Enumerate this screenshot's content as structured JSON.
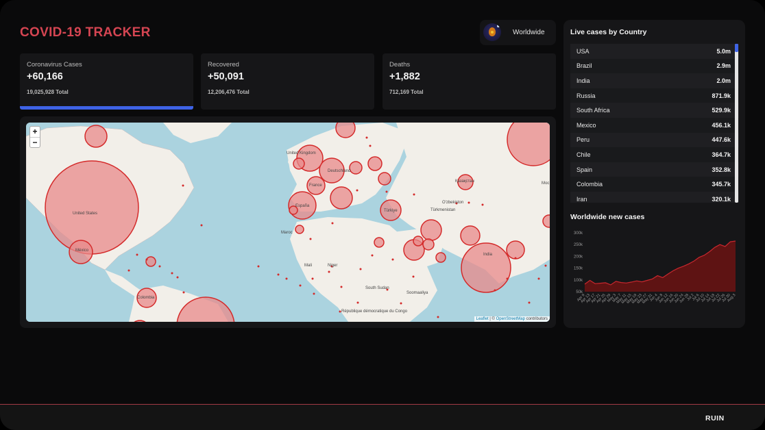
{
  "header": {
    "title": "COVID-19 TRACKER"
  },
  "country_select": {
    "selected": "Worldwide",
    "icon": "owl-globe-icon"
  },
  "stats": [
    {
      "title": "Coronavirus Cases",
      "value": "+60,166",
      "total": "19,025,928 Total",
      "active": true
    },
    {
      "title": "Recovered",
      "value": "+50,091",
      "total": "12,206,476 Total",
      "active": false
    },
    {
      "title": "Deaths",
      "value": "+1,882",
      "total": "712,169 Total",
      "active": false
    }
  ],
  "map": {
    "zoom_in": "+",
    "zoom_out": "−",
    "attribution_leaflet": "Leaflet",
    "attribution_sep": " | © ",
    "attribution_osm": "OpenStreetMap",
    "attribution_tail": " contributors",
    "labels": {
      "us": "United States",
      "mexico": "México",
      "france": "France",
      "espana": "España",
      "turkey": "Türkiye",
      "india": "India",
      "colombia": "Colombia",
      "niger": "Niger",
      "mali": "Mali",
      "south_sudan": "South Sudan",
      "rdc": "République démocratique du Congo",
      "soomaaliya": "Soomaaliya",
      "kazakhstan": "Қазақстан",
      "turkmenistan": "Türkmenistan",
      "uzbekistan": "O'zbekiston",
      "maroc": "Maroc",
      "united_kingdom": "United Kingdom",
      "deutschland": "Deutschland",
      "moscow": "Мос"
    },
    "colors": {
      "circle_fill": "#e88a8a",
      "circle_stroke": "#d42a2a",
      "water": "#abd3df",
      "land": "#f2efe9"
    }
  },
  "sidebar": {
    "live_title": "Live cases by Country",
    "countries": [
      {
        "name": "USA",
        "cases": "5.0m"
      },
      {
        "name": "Brazil",
        "cases": "2.9m"
      },
      {
        "name": "India",
        "cases": "2.0m"
      },
      {
        "name": "Russia",
        "cases": "871.9k"
      },
      {
        "name": "South Africa",
        "cases": "529.9k"
      },
      {
        "name": "Mexico",
        "cases": "456.1k"
      },
      {
        "name": "Peru",
        "cases": "447.6k"
      },
      {
        "name": "Chile",
        "cases": "364.7k"
      },
      {
        "name": "Spain",
        "cases": "352.8k"
      },
      {
        "name": "Colombia",
        "cases": "345.7k"
      },
      {
        "name": "Iran",
        "cases": "320.1k"
      }
    ],
    "chart_title": "Worldwide new cases"
  },
  "chart_data": {
    "type": "area",
    "ylim": [
      50000,
      300000
    ],
    "yticks": [
      "50k",
      "100k",
      "150k",
      "200k",
      "250k",
      "300k"
    ],
    "ytick_values": [
      50000,
      100000,
      150000,
      200000,
      250000,
      300000
    ],
    "x": [
      "Apr 9",
      "Apr 13",
      "Apr 17",
      "Apr 21",
      "Apr 25",
      "Apr 29",
      "May 3",
      "May 7",
      "May 11",
      "May 15",
      "May 19",
      "May 23",
      "May 27",
      "May 31",
      "Jun 4",
      "Jun 8",
      "Jun 12",
      "Jun 16",
      "Jun 20",
      "Jun 24",
      "Jun 28",
      "Jul 2",
      "Jul 6",
      "Jul 10",
      "Jul 14",
      "Jul 18",
      "Jul 22",
      "Jul 26",
      "Jul 30",
      "Aug 3"
    ],
    "values": [
      82000,
      98000,
      84000,
      86000,
      88000,
      79000,
      94000,
      89000,
      87000,
      91000,
      96000,
      92000,
      98000,
      104000,
      118000,
      110000,
      125000,
      139000,
      150000,
      158000,
      168000,
      180000,
      196000,
      205000,
      220000,
      238000,
      250000,
      242000,
      262000,
      265000
    ],
    "colors": {
      "line": "#c8272e",
      "fill": "#5e1313"
    }
  },
  "footer": {
    "brand": "RUIN"
  }
}
